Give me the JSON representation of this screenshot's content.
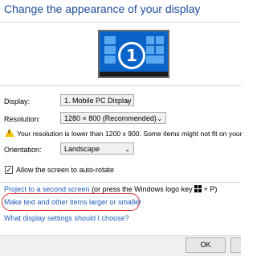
{
  "window": {
    "title": "Change the appearance of your display"
  },
  "preview": {
    "monitor_number": "1"
  },
  "display": {
    "label": "Display:",
    "value": "1. Mobile PC Display"
  },
  "resolution": {
    "label": "Resolution:",
    "value": "1280 × 800 (Recommended)",
    "warning": "Your resolution is lower than 1200 x 900. Some items might not fit on your"
  },
  "orientation": {
    "label": "Orientation:",
    "value": "Landscape"
  },
  "auto_rotate": {
    "label": "Allow the screen to auto-rotate",
    "checked": true
  },
  "links": {
    "project": "Project to a second screen",
    "project_suffix": " (or press the Windows logo key ",
    "project_end": " + P)",
    "text_size": "Make text and other items larger or smaller",
    "help": "What display settings should I choose?"
  },
  "buttons": {
    "ok": "OK"
  },
  "colors": {
    "accent": "#1f4e9a",
    "link": "#1f5fbf",
    "highlight": "#d9303a",
    "warning": "#f2c200"
  }
}
